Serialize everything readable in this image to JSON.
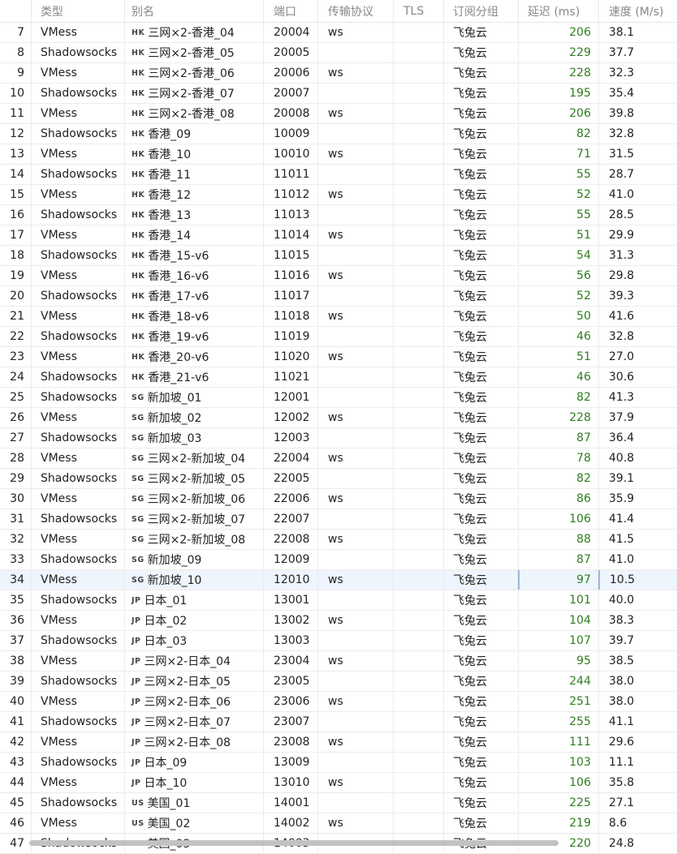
{
  "columns": {
    "index": "",
    "type": "类型",
    "name": "别名",
    "port": "端口",
    "network": "传输协议",
    "tls": "TLS",
    "group": "订阅分组",
    "latency": "延迟 (ms)",
    "speed": "速度 (M/s)"
  },
  "selected_index": "34",
  "rows": [
    {
      "idx": "7",
      "type": "VMess",
      "flag": "HK",
      "name": "三网×2-香港_04",
      "port": "20004",
      "net": "ws",
      "tls": "",
      "group": "飞兔云",
      "lat": "206",
      "spd": "38.1"
    },
    {
      "idx": "8",
      "type": "Shadowsocks",
      "flag": "HK",
      "name": "三网×2-香港_05",
      "port": "20005",
      "net": "",
      "tls": "",
      "group": "飞兔云",
      "lat": "229",
      "spd": "37.7"
    },
    {
      "idx": "9",
      "type": "VMess",
      "flag": "HK",
      "name": "三网×2-香港_06",
      "port": "20006",
      "net": "ws",
      "tls": "",
      "group": "飞兔云",
      "lat": "228",
      "spd": "32.3"
    },
    {
      "idx": "10",
      "type": "Shadowsocks",
      "flag": "HK",
      "name": "三网×2-香港_07",
      "port": "20007",
      "net": "",
      "tls": "",
      "group": "飞兔云",
      "lat": "195",
      "spd": "35.4"
    },
    {
      "idx": "11",
      "type": "VMess",
      "flag": "HK",
      "name": "三网×2-香港_08",
      "port": "20008",
      "net": "ws",
      "tls": "",
      "group": "飞兔云",
      "lat": "206",
      "spd": "39.8"
    },
    {
      "idx": "12",
      "type": "Shadowsocks",
      "flag": "HK",
      "name": "香港_09",
      "port": "10009",
      "net": "",
      "tls": "",
      "group": "飞兔云",
      "lat": "82",
      "spd": "32.8"
    },
    {
      "idx": "13",
      "type": "VMess",
      "flag": "HK",
      "name": "香港_10",
      "port": "10010",
      "net": "ws",
      "tls": "",
      "group": "飞兔云",
      "lat": "71",
      "spd": "31.5"
    },
    {
      "idx": "14",
      "type": "Shadowsocks",
      "flag": "HK",
      "name": "香港_11",
      "port": "11011",
      "net": "",
      "tls": "",
      "group": "飞兔云",
      "lat": "55",
      "spd": "28.7"
    },
    {
      "idx": "15",
      "type": "VMess",
      "flag": "HK",
      "name": "香港_12",
      "port": "11012",
      "net": "ws",
      "tls": "",
      "group": "飞兔云",
      "lat": "52",
      "spd": "41.0"
    },
    {
      "idx": "16",
      "type": "Shadowsocks",
      "flag": "HK",
      "name": "香港_13",
      "port": "11013",
      "net": "",
      "tls": "",
      "group": "飞兔云",
      "lat": "55",
      "spd": "28.5"
    },
    {
      "idx": "17",
      "type": "VMess",
      "flag": "HK",
      "name": "香港_14",
      "port": "11014",
      "net": "ws",
      "tls": "",
      "group": "飞兔云",
      "lat": "51",
      "spd": "29.9"
    },
    {
      "idx": "18",
      "type": "Shadowsocks",
      "flag": "HK",
      "name": "香港_15-v6",
      "port": "11015",
      "net": "",
      "tls": "",
      "group": "飞兔云",
      "lat": "54",
      "spd": "31.3"
    },
    {
      "idx": "19",
      "type": "VMess",
      "flag": "HK",
      "name": "香港_16-v6",
      "port": "11016",
      "net": "ws",
      "tls": "",
      "group": "飞兔云",
      "lat": "56",
      "spd": "29.8"
    },
    {
      "idx": "20",
      "type": "Shadowsocks",
      "flag": "HK",
      "name": "香港_17-v6",
      "port": "11017",
      "net": "",
      "tls": "",
      "group": "飞兔云",
      "lat": "52",
      "spd": "39.3"
    },
    {
      "idx": "21",
      "type": "VMess",
      "flag": "HK",
      "name": "香港_18-v6",
      "port": "11018",
      "net": "ws",
      "tls": "",
      "group": "飞兔云",
      "lat": "50",
      "spd": "41.6"
    },
    {
      "idx": "22",
      "type": "Shadowsocks",
      "flag": "HK",
      "name": "香港_19-v6",
      "port": "11019",
      "net": "",
      "tls": "",
      "group": "飞兔云",
      "lat": "46",
      "spd": "32.8"
    },
    {
      "idx": "23",
      "type": "VMess",
      "flag": "HK",
      "name": "香港_20-v6",
      "port": "11020",
      "net": "ws",
      "tls": "",
      "group": "飞兔云",
      "lat": "51",
      "spd": "27.0"
    },
    {
      "idx": "24",
      "type": "Shadowsocks",
      "flag": "HK",
      "name": "香港_21-v6",
      "port": "11021",
      "net": "",
      "tls": "",
      "group": "飞兔云",
      "lat": "46",
      "spd": "30.6"
    },
    {
      "idx": "25",
      "type": "Shadowsocks",
      "flag": "SG",
      "name": "新加坡_01",
      "port": "12001",
      "net": "",
      "tls": "",
      "group": "飞兔云",
      "lat": "82",
      "spd": "41.3"
    },
    {
      "idx": "26",
      "type": "VMess",
      "flag": "SG",
      "name": "新加坡_02",
      "port": "12002",
      "net": "ws",
      "tls": "",
      "group": "飞兔云",
      "lat": "228",
      "spd": "37.9"
    },
    {
      "idx": "27",
      "type": "Shadowsocks",
      "flag": "SG",
      "name": "新加坡_03",
      "port": "12003",
      "net": "",
      "tls": "",
      "group": "飞兔云",
      "lat": "87",
      "spd": "36.4"
    },
    {
      "idx": "28",
      "type": "VMess",
      "flag": "SG",
      "name": "三网×2-新加坡_04",
      "port": "22004",
      "net": "ws",
      "tls": "",
      "group": "飞兔云",
      "lat": "78",
      "spd": "40.8"
    },
    {
      "idx": "29",
      "type": "Shadowsocks",
      "flag": "SG",
      "name": "三网×2-新加坡_05",
      "port": "22005",
      "net": "",
      "tls": "",
      "group": "飞兔云",
      "lat": "82",
      "spd": "39.1"
    },
    {
      "idx": "30",
      "type": "VMess",
      "flag": "SG",
      "name": "三网×2-新加坡_06",
      "port": "22006",
      "net": "ws",
      "tls": "",
      "group": "飞兔云",
      "lat": "86",
      "spd": "35.9"
    },
    {
      "idx": "31",
      "type": "Shadowsocks",
      "flag": "SG",
      "name": "三网×2-新加坡_07",
      "port": "22007",
      "net": "",
      "tls": "",
      "group": "飞兔云",
      "lat": "106",
      "spd": "41.4"
    },
    {
      "idx": "32",
      "type": "VMess",
      "flag": "SG",
      "name": "三网×2-新加坡_08",
      "port": "22008",
      "net": "ws",
      "tls": "",
      "group": "飞兔云",
      "lat": "88",
      "spd": "41.5"
    },
    {
      "idx": "33",
      "type": "Shadowsocks",
      "flag": "SG",
      "name": "新加坡_09",
      "port": "12009",
      "net": "",
      "tls": "",
      "group": "飞兔云",
      "lat": "87",
      "spd": "41.0"
    },
    {
      "idx": "34",
      "type": "VMess",
      "flag": "SG",
      "name": "新加坡_10",
      "port": "12010",
      "net": "ws",
      "tls": "",
      "group": "飞兔云",
      "lat": "97",
      "spd": "10.5"
    },
    {
      "idx": "35",
      "type": "Shadowsocks",
      "flag": "JP",
      "name": "日本_01",
      "port": "13001",
      "net": "",
      "tls": "",
      "group": "飞兔云",
      "lat": "101",
      "spd": "40.0"
    },
    {
      "idx": "36",
      "type": "VMess",
      "flag": "JP",
      "name": "日本_02",
      "port": "13002",
      "net": "ws",
      "tls": "",
      "group": "飞兔云",
      "lat": "104",
      "spd": "38.3"
    },
    {
      "idx": "37",
      "type": "Shadowsocks",
      "flag": "JP",
      "name": "日本_03",
      "port": "13003",
      "net": "",
      "tls": "",
      "group": "飞兔云",
      "lat": "107",
      "spd": "39.7"
    },
    {
      "idx": "38",
      "type": "VMess",
      "flag": "JP",
      "name": "三网×2-日本_04",
      "port": "23004",
      "net": "ws",
      "tls": "",
      "group": "飞兔云",
      "lat": "95",
      "spd": "38.5"
    },
    {
      "idx": "39",
      "type": "Shadowsocks",
      "flag": "JP",
      "name": "三网×2-日本_05",
      "port": "23005",
      "net": "",
      "tls": "",
      "group": "飞兔云",
      "lat": "244",
      "spd": "38.0"
    },
    {
      "idx": "40",
      "type": "VMess",
      "flag": "JP",
      "name": "三网×2-日本_06",
      "port": "23006",
      "net": "ws",
      "tls": "",
      "group": "飞兔云",
      "lat": "251",
      "spd": "38.0"
    },
    {
      "idx": "41",
      "type": "Shadowsocks",
      "flag": "JP",
      "name": "三网×2-日本_07",
      "port": "23007",
      "net": "",
      "tls": "",
      "group": "飞兔云",
      "lat": "255",
      "spd": "41.1"
    },
    {
      "idx": "42",
      "type": "VMess",
      "flag": "JP",
      "name": "三网×2-日本_08",
      "port": "23008",
      "net": "ws",
      "tls": "",
      "group": "飞兔云",
      "lat": "111",
      "spd": "29.6"
    },
    {
      "idx": "43",
      "type": "Shadowsocks",
      "flag": "JP",
      "name": "日本_09",
      "port": "13009",
      "net": "",
      "tls": "",
      "group": "飞兔云",
      "lat": "103",
      "spd": "11.1"
    },
    {
      "idx": "44",
      "type": "VMess",
      "flag": "JP",
      "name": "日本_10",
      "port": "13010",
      "net": "ws",
      "tls": "",
      "group": "飞兔云",
      "lat": "106",
      "spd": "35.8"
    },
    {
      "idx": "45",
      "type": "Shadowsocks",
      "flag": "US",
      "name": "美国_01",
      "port": "14001",
      "net": "",
      "tls": "",
      "group": "飞兔云",
      "lat": "225",
      "spd": "27.1"
    },
    {
      "idx": "46",
      "type": "VMess",
      "flag": "US",
      "name": "美国_02",
      "port": "14002",
      "net": "ws",
      "tls": "",
      "group": "飞兔云",
      "lat": "219",
      "spd": "8.6"
    },
    {
      "idx": "47",
      "type": "Shadowsocks",
      "flag": "US",
      "name": "美国_03",
      "port": "14003",
      "net": "",
      "tls": "",
      "group": "飞兔云",
      "lat": "220",
      "spd": "24.8"
    }
  ]
}
